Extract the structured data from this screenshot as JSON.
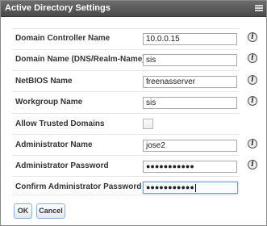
{
  "dialog": {
    "title": "Active Directory Settings"
  },
  "form": {
    "domain_controller": {
      "label": "Domain Controller Name",
      "value": "10.0.0.15"
    },
    "domain_name": {
      "label": "Domain Name (DNS/Realm-Name)",
      "value": "sis"
    },
    "netbios": {
      "label": "NetBIOS Name",
      "value": "freenasserver"
    },
    "workgroup": {
      "label": "Workgroup Name",
      "value": "sis"
    },
    "trusted": {
      "label": "Allow Trusted Domains",
      "checked": false
    },
    "admin_name": {
      "label": "Administrator Name",
      "value": "jose2"
    },
    "admin_password": {
      "label": "Administrator Password",
      "masked": "●●●●●●●●●●●"
    },
    "confirm_password": {
      "label": "Confirm Administrator Password",
      "masked": "●●●●●●●●●●●"
    }
  },
  "help_glyph": "i",
  "buttons": {
    "ok": "OK",
    "cancel": "Cancel"
  }
}
